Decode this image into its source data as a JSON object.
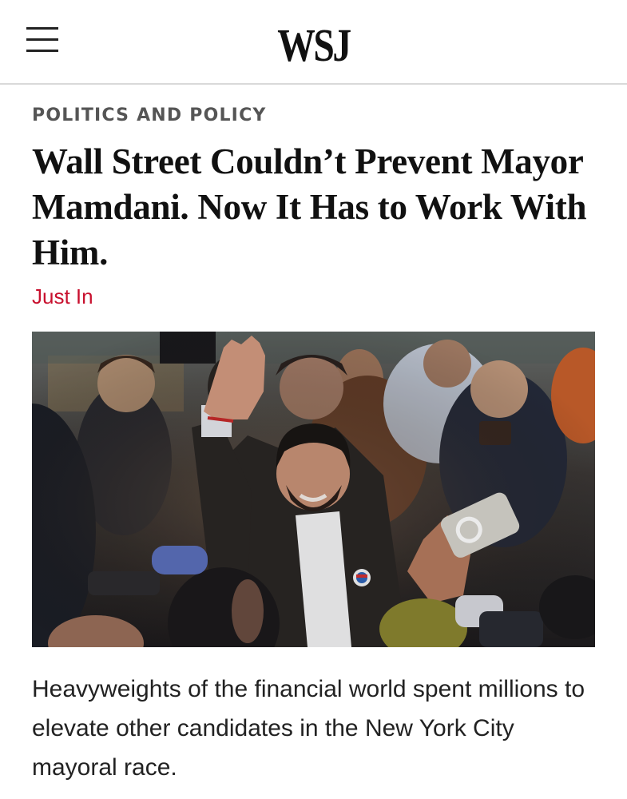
{
  "header": {
    "logo_text": "WSJ",
    "menu_icon": "hamburger-menu-icon"
  },
  "article": {
    "section": "POLITICS AND POLICY",
    "headline": "Wall Street Couldn’t Prevent Mayor Mamdani. Now It Has to Work With Him.",
    "flag": "Just In",
    "dek": "Heavyweights of the financial world spent millions to elevate other candidates in the New York City mayoral race."
  },
  "colors": {
    "flag": "#c8102e",
    "section": "#555555",
    "text": "#111111",
    "divider": "#d9d9d9"
  }
}
